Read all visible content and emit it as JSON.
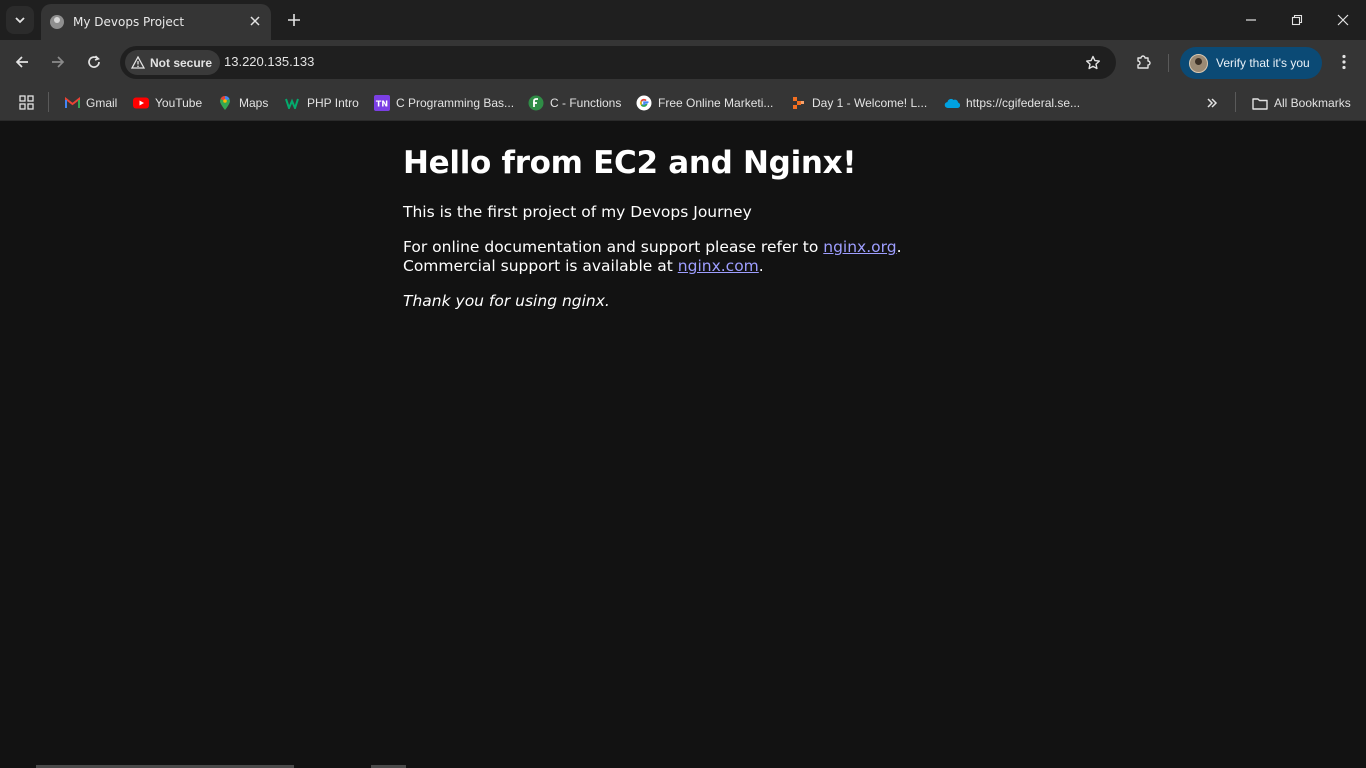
{
  "browser": {
    "tab": {
      "title": "My Devops Project"
    },
    "toolbar": {
      "security_label": "Not secure",
      "url": "13.220.135.133",
      "profile_label": "Verify that it's you"
    },
    "bookmarks": [
      {
        "label": "Gmail",
        "icon": "gmail-icon"
      },
      {
        "label": "YouTube",
        "icon": "youtube-icon"
      },
      {
        "label": "Maps",
        "icon": "maps-icon"
      },
      {
        "label": "PHP Intro",
        "icon": "w3schools-icon"
      },
      {
        "label": "C Programming Bas...",
        "icon": "tn-icon"
      },
      {
        "label": "C - Functions",
        "icon": "green-logo-icon"
      },
      {
        "label": "Free Online Marketi...",
        "icon": "google-icon"
      },
      {
        "label": "Day 1 - Welcome! L...",
        "icon": "orange-logo-icon"
      },
      {
        "label": "https://cgifederal.se...",
        "icon": "salesforce-cloud-icon"
      }
    ],
    "all_bookmarks_label": "All Bookmarks",
    "accent_color": "#0b4a75"
  },
  "page": {
    "heading": "Hello from EC2 and Nginx!",
    "intro": "This is the first project of my Devops Journey",
    "docs_prefix": "For online documentation and support please refer to ",
    "docs_link": "nginx.org",
    "docs_suffix": ".",
    "support_prefix": "Commercial support is available at ",
    "support_link": "nginx.com",
    "support_suffix": ".",
    "thanks": "Thank you for using nginx.",
    "link_color": "#9e9eff"
  }
}
